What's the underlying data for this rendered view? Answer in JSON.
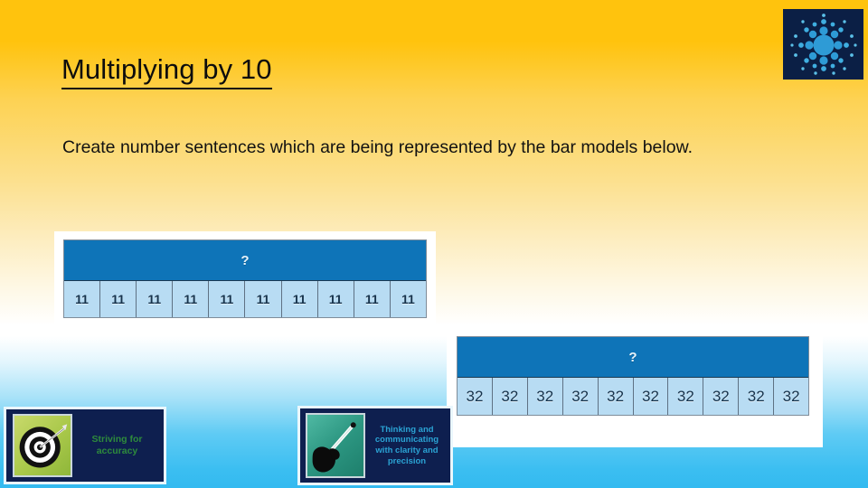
{
  "slide": {
    "title": "Multiplying by 10",
    "body": "Create number sentences which are being represented by the bar models below.",
    "background": {
      "top_color": "#FFC30D",
      "mid_color": "#FFFFFF",
      "bottom_color": "#33BAF0"
    }
  },
  "bar_models": [
    {
      "id": "bar-model-1",
      "total_label": "?",
      "part_value": "11",
      "part_count": 10,
      "parts": [
        "11",
        "11",
        "11",
        "11",
        "11",
        "11",
        "11",
        "11",
        "11",
        "11"
      ],
      "total_color": "#0E74B8",
      "part_color": "#B8DCF3"
    },
    {
      "id": "bar-model-2",
      "total_label": "?",
      "part_value": "32",
      "part_count": 10,
      "parts": [
        "32",
        "32",
        "32",
        "32",
        "32",
        "32",
        "32",
        "32",
        "32",
        "32"
      ],
      "total_color": "#0E74B8",
      "part_color": "#B8DCF3"
    }
  ],
  "habit_cards": [
    {
      "id": "striving-for-accuracy",
      "label": "Striving for accuracy",
      "icon": "target-dartboard-icon",
      "text_color": "#2E8B3C",
      "card_color": "#0E1F4F"
    },
    {
      "id": "clarity-and-precision",
      "label": "Thinking and communicating with clarity and precision",
      "icon": "hand-holding-pencil-icon",
      "text_color": "#2BA3D4",
      "card_color": "#0E1F4F"
    }
  ],
  "logo": {
    "name": "starburst-dots-logo",
    "background_color": "#0B1F45",
    "accent_color": "#2E9BD6"
  }
}
